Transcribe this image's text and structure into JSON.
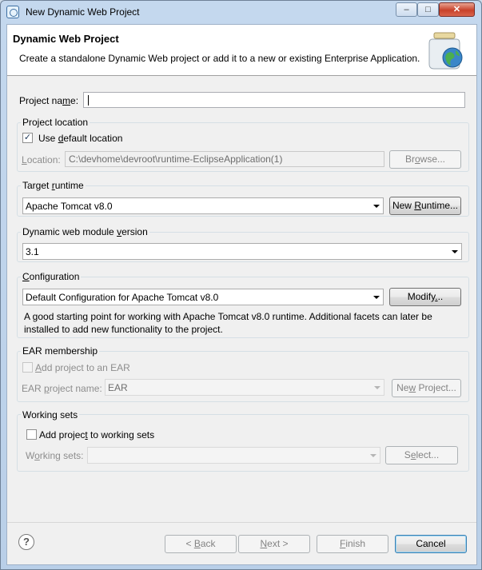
{
  "window": {
    "title": "New Dynamic Web Project",
    "controls": {
      "minimize": "–",
      "maximize": "□",
      "close": "✕"
    }
  },
  "header": {
    "title": "Dynamic Web Project",
    "description": "Create a standalone Dynamic Web project or add it to a new or existing Enterprise Application."
  },
  "project_name": {
    "label_pre": "Project na",
    "label_mn": "m",
    "label_post": "e:",
    "value": ""
  },
  "project_location": {
    "group_label": "Project location",
    "use_default": {
      "label_pre": "Use ",
      "label_mn": "d",
      "label_post": "efault location",
      "checked": true,
      "check_mark": "✓"
    },
    "location_label_pre": "",
    "location_label_mn": "L",
    "location_label_post": "ocation:",
    "location_value": "C:\\devhome\\devroot\\runtime-EclipseApplication(1)",
    "browse_pre": "Br",
    "browse_mn": "o",
    "browse_post": "wse..."
  },
  "target_runtime": {
    "group_label_pre": "Target ",
    "group_label_mn": "r",
    "group_label_post": "untime",
    "selected": "Apache Tomcat v8.0",
    "new_runtime_pre": "New ",
    "new_runtime_mn": "R",
    "new_runtime_post": "untime..."
  },
  "module_version": {
    "group_label_pre": "Dynamic web module ",
    "group_label_mn": "v",
    "group_label_post": "ersion",
    "selected": "3.1"
  },
  "configuration": {
    "group_label_pre": "",
    "group_label_mn": "C",
    "group_label_post": "onfiguration",
    "selected": "Default Configuration for Apache Tomcat v8.0",
    "modify_pre": "Modify",
    "modify_mn": ".",
    "modify_post": "..",
    "description_line1": "A good starting point for working with Apache Tomcat v8.0 runtime. Additional facets can later be",
    "description_line2": "installed to add new functionality to the project."
  },
  "ear": {
    "group_label": "EAR membership",
    "add_label_pre": "",
    "add_label_mn": "A",
    "add_label_post": "dd project to an EAR",
    "add_checked": false,
    "project_label_pre": "EAR ",
    "project_label_mn": "p",
    "project_label_post": "roject name:",
    "project_value": "EAR",
    "new_project_pre": "Ne",
    "new_project_mn": "w",
    "new_project_post": " Project..."
  },
  "working_sets": {
    "group_label": "Working sets",
    "add_label_pre": "Add projec",
    "add_label_mn": "t",
    "add_label_post": " to working sets",
    "add_checked": false,
    "sets_label_pre": "W",
    "sets_label_mn": "o",
    "sets_label_post": "rking sets:",
    "sets_value": "",
    "select_pre": "S",
    "select_mn": "e",
    "select_post": "lect..."
  },
  "footer": {
    "help": "?",
    "back_pre": "< ",
    "back_mn": "B",
    "back_post": "ack",
    "next_pre": "",
    "next_mn": "N",
    "next_post": "ext >",
    "finish_pre": "",
    "finish_mn": "F",
    "finish_post": "inish",
    "cancel": "Cancel"
  },
  "colors": {
    "accent": "#3c7fb1",
    "title_bar": "#c4d8ee",
    "dialog_bg": "#f0f0f0",
    "close_button": "#c8412a"
  }
}
